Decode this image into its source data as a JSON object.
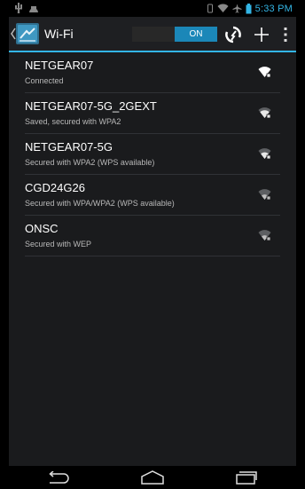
{
  "status_bar": {
    "time": "5:33 PM",
    "left_icons": [
      "usb-icon",
      "android-debug-icon"
    ],
    "right_icons": [
      "vibrate-icon",
      "wifi-signal-icon",
      "airplane-mode-icon",
      "battery-icon"
    ]
  },
  "action_bar": {
    "title": "Wi-Fi",
    "app_icon": "wifi-settings-icon",
    "toggle_label": "ON",
    "actions": [
      "wps-push-icon",
      "add-network-icon",
      "overflow-menu-icon"
    ]
  },
  "networks": [
    {
      "name": "NETGEAR07",
      "status": "Connected"
    },
    {
      "name": "NETGEAR07-5G_2GEXT",
      "status": "Saved, secured with WPA2"
    },
    {
      "name": "NETGEAR07-5G",
      "status": "Secured with WPA2 (WPS available)"
    },
    {
      "name": "CGD24G26",
      "status": "Secured with WPA/WPA2 (WPS available)"
    },
    {
      "name": "ONSC",
      "status": "Secured with WEP"
    }
  ],
  "colors": {
    "accent": "#33b5e5",
    "toggle_on": "#1b87b8",
    "background": "#1a1b1d"
  },
  "nav_bar": [
    "back-icon",
    "home-icon",
    "recent-apps-icon"
  ]
}
